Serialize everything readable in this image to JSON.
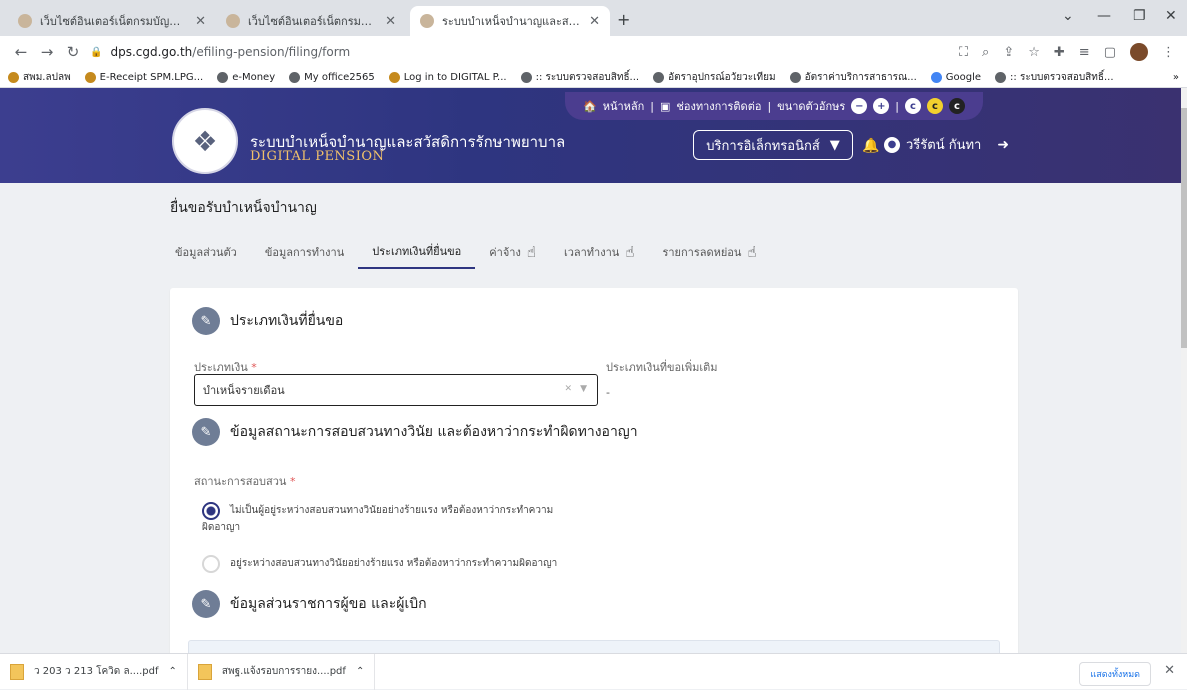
{
  "browser": {
    "tabs": [
      {
        "label": "เว็บไซต์อินเตอร์เน็ตกรมบัญชีกลาง"
      },
      {
        "label": "เว็บไซต์อินเตอร์เน็ตกรมบัญชีกลาง"
      },
      {
        "label": "ระบบบำเหน็จบำนาญและสวัสดิการรักษ"
      }
    ],
    "new_tab": "+",
    "url_host": "dps.cgd.go.th",
    "url_path": "/efiling-pension/filing/form",
    "bookmarks": [
      "สพม.ลปลพ",
      "E-Receipt SPM.LPG...",
      "e-Money",
      "My office2565",
      "Log in to DIGITAL P...",
      ":: ระบบตรวจสอบสิทธิ์...",
      "อัตราอุปกรณ์อวัยวะเทียม",
      "อัตราค่าบริการสาธารณ...",
      "Google",
      ":: ระบบตรวจสอบสิทธิ์..."
    ],
    "bookmarks_more": "»"
  },
  "header": {
    "site_title": "ระบบบำเหน็จบำนาญและสวัสดิการรักษาพยาบาล",
    "site_subtitle": "DIGITAL PENSION",
    "top_strip": {
      "home": "หน้าหลัก",
      "contact": "ช่องทางการติดต่อ",
      "font_size": "ขนาดตัวอักษร"
    },
    "service_button": "บริการอิเล็กทรอนิกส์",
    "user_name": "วรีรัตน์ กันทา"
  },
  "page": {
    "title": "ยื่นขอรับบำเหน็จบำนาญ",
    "tabs": [
      {
        "label": "ข้อมูลส่วนตัว",
        "active": false,
        "hand": false
      },
      {
        "label": "ข้อมูลการทำงาน",
        "active": false,
        "hand": false
      },
      {
        "label": "ประเภทเงินที่ยื่นขอ",
        "active": true,
        "hand": false
      },
      {
        "label": "ค่าจ้าง",
        "active": false,
        "hand": true
      },
      {
        "label": "เวลาทำงาน",
        "active": false,
        "hand": true
      },
      {
        "label": "รายการลดหย่อน",
        "active": false,
        "hand": true
      }
    ]
  },
  "form": {
    "section1_title": "ประเภทเงินที่ยื่นขอ",
    "money_type_label": "ประเภทเงิน",
    "money_type_required": "*",
    "money_type_value": "บำเหน็จรายเดือน",
    "extra_money_label": "ประเภทเงินที่ขอเพิ่มเติม",
    "extra_money_value": "-",
    "section2_title": "ข้อมูลสถานะการสอบสวนทางวินัย และต้องหาว่ากระทำผิดทางอาญา",
    "investigation_label": "สถานะการสอบสวน",
    "investigation_required": "*",
    "option1_line1": "ไม่เป็นผู้อยู่ระหว่างสอบสวนทางวินัยอย่างร้ายแรง หรือต้องหาว่ากระทำความ",
    "option1_line2": "ผิดอาญา",
    "option2": "อยู่ระหว่างสอบสวนทางวินัยอย่างร้ายแรง หรือต้องหาว่ากระทำความผิดอาญา",
    "selected_option": 1,
    "section3_title": "ข้อมูลส่วนราชการผู้ขอ และผู้เบิก"
  },
  "downloads": {
    "items": [
      {
        "name": "ว 203 ว 213 โควิด ล....pdf"
      },
      {
        "name": "สพฐ.แจ้งรอบการรายง....pdf"
      }
    ],
    "show_all": "แสดงทั้งหมด"
  },
  "colors": {
    "header_blue": "#2e3580",
    "accent_yellow": "#f1c16a",
    "pencil_gray": "#6f7d96",
    "status_green": "#3fbf7a"
  }
}
